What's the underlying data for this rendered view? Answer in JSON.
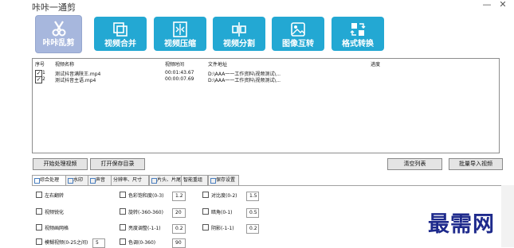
{
  "window": {
    "title": "咔咔一通剪",
    "minimize_label": "—",
    "close_label": "✕"
  },
  "toolbar": {
    "items": [
      {
        "label": "咔咔乱剪",
        "icon": "scissors-icon"
      },
      {
        "label": "视频合并",
        "icon": "merge-icon"
      },
      {
        "label": "视频压缩",
        "icon": "compress-icon"
      },
      {
        "label": "视频分割",
        "icon": "split-icon"
      },
      {
        "label": "图像互转",
        "icon": "image-icon"
      },
      {
        "label": "格式转换",
        "icon": "convert-icon"
      }
    ]
  },
  "list": {
    "headers": [
      "序号",
      "视频名称",
      "视频时间",
      "文件地址",
      "进度"
    ],
    "rows": [
      {
        "index": "1",
        "name": "测试抖音满陕王.mp4",
        "duration": "00:01:43.67",
        "path": "D:\\AAA一一工作资料\\视频测试\\...",
        "progress": "",
        "checked": true
      },
      {
        "index": "2",
        "name": "测试抖音主语.mp4",
        "duration": "00:00:07.69",
        "path": "D:\\AAA一一工作资料\\视频测试\\...",
        "progress": "",
        "checked": true
      }
    ]
  },
  "actions": {
    "start": "开始处理视频",
    "open_dir": "打开保存目录",
    "clear": "清空列表",
    "batch_import": "批量导入视频"
  },
  "tabs": [
    "综合处理",
    "水印",
    "声音",
    "分辨率、尺寸",
    "片头、片尾",
    "智能重组",
    "保存设置"
  ],
  "options": {
    "flip": "左右翻转",
    "sharpen": "视频锐化",
    "grid": "视频画网格",
    "blur": "模糊视频(0-25之间)",
    "blur_value": "5",
    "saturation": "色彩饱和度(0-3)",
    "saturation_value": "1.2",
    "rotate": "旋转(-360-360)",
    "rotate_value": "20",
    "brightness": "亮度调整(-1-1)",
    "brightness_value": "0.2",
    "hue": "色调(0-360)",
    "hue_value": "90",
    "contrast": "对比度(0-2)",
    "contrast_value": "1.5",
    "corner": "暗角(0-1)",
    "corner_value": "0.5",
    "shadow": "阴影(-1-1)",
    "shadow_value": "0.2"
  },
  "watermark": "最需网"
}
